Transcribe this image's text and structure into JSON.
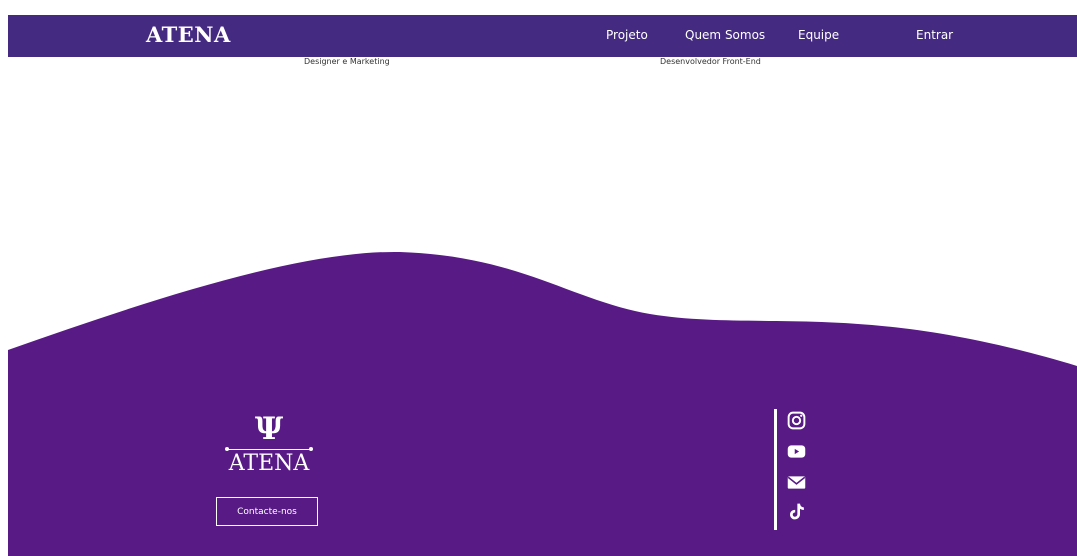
{
  "navbar": {
    "brand": "ATENA",
    "links": [
      {
        "label": "Projeto"
      },
      {
        "label": "Quem Somos"
      },
      {
        "label": "Equipe"
      },
      {
        "label": "Entrar"
      }
    ]
  },
  "team": {
    "roles": [
      "Designer e Marketing",
      "Desenvolvedor Front-End"
    ]
  },
  "footer": {
    "logo_symbol": "Ψ",
    "brand": "ATENA",
    "contact_label": "Contacte-nos",
    "social": [
      {
        "icon": "instagram-icon"
      },
      {
        "icon": "youtube-icon"
      },
      {
        "icon": "email-icon"
      },
      {
        "icon": "tiktok-icon"
      }
    ]
  },
  "colors": {
    "navbar": "#452a82",
    "footer": "#581b85",
    "text_on_dark": "#ffffff"
  }
}
